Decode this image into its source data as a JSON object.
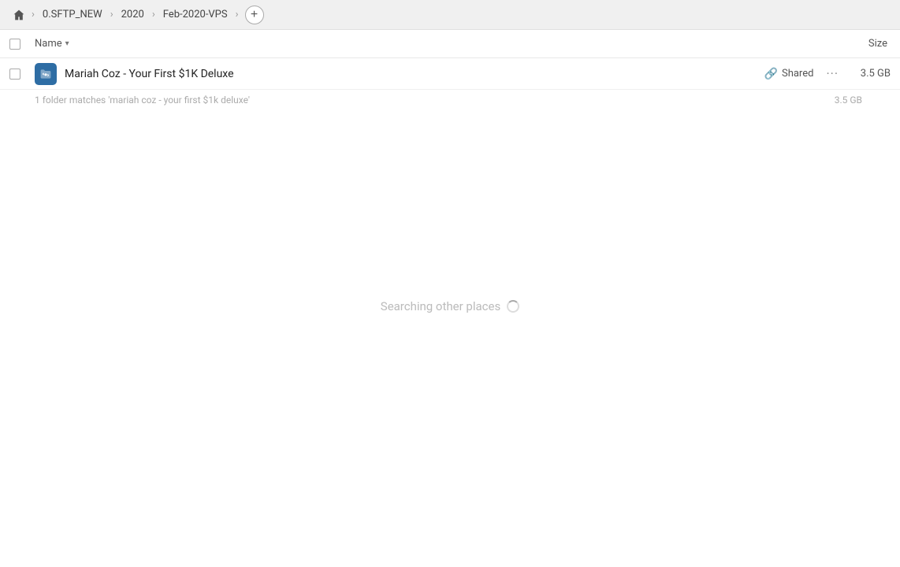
{
  "topbar": {
    "home_title": "Home",
    "breadcrumbs": [
      {
        "label": "0.SFTP_NEW"
      },
      {
        "label": "2020"
      },
      {
        "label": "Feb-2020-VPS"
      }
    ],
    "add_button_label": "+"
  },
  "columns": {
    "name_label": "Name",
    "size_label": "Size"
  },
  "file_row": {
    "icon_name": "folder-link-icon",
    "name": "Mariah Coz - Your First $1K Deluxe",
    "shared_label": "Shared",
    "more_label": "···",
    "size": "3.5 GB"
  },
  "summary": {
    "text": "1 folder matches 'mariah coz - your first $1k deluxe'",
    "size": "3.5 GB"
  },
  "searching": {
    "text": "Searching other places"
  }
}
